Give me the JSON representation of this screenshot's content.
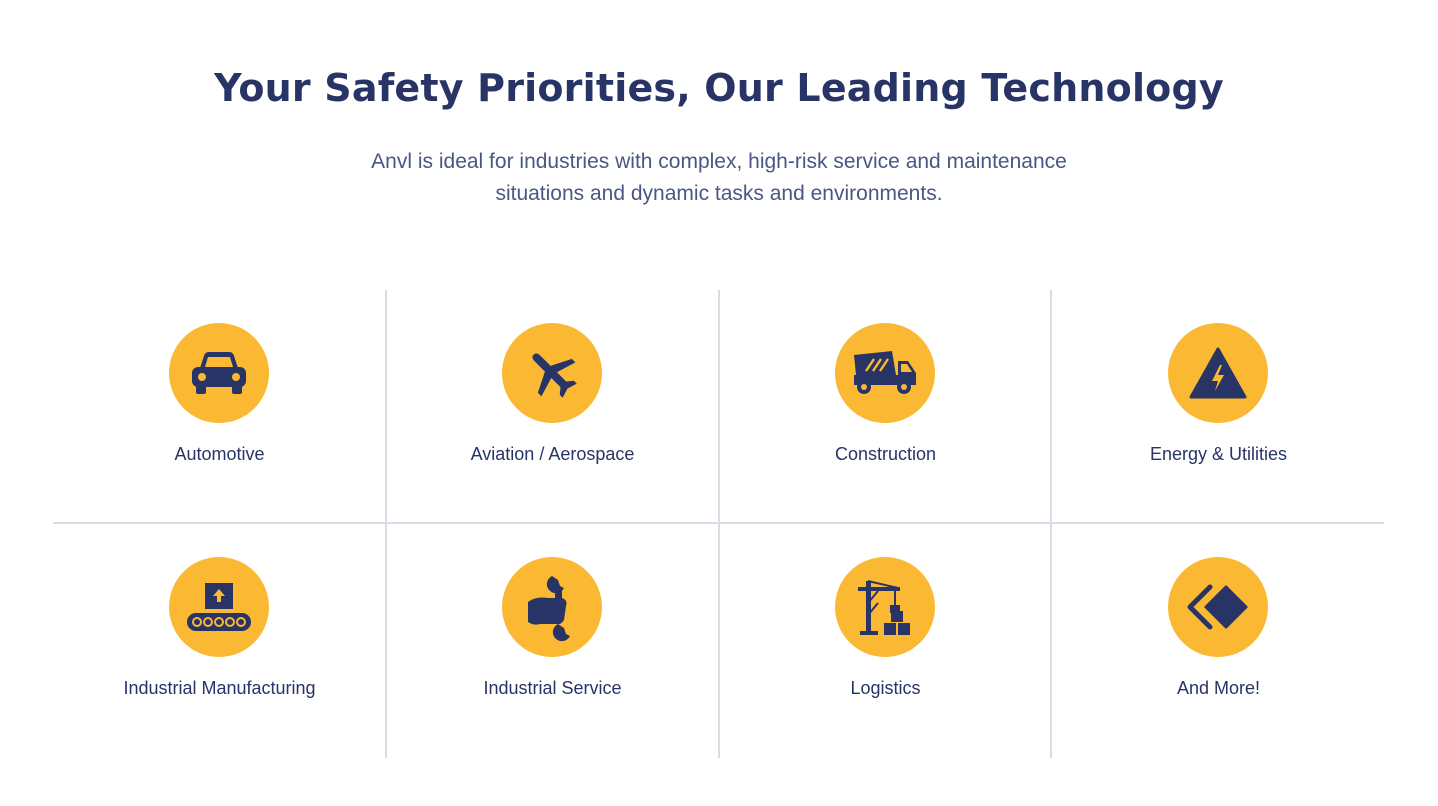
{
  "header": {
    "title": "Your Safety Priorities, Our Leading Technology",
    "subtitle_line1": "Anvl is ideal for industries with complex, high-risk service and maintenance",
    "subtitle_line2": "situations and dynamic tasks and environments."
  },
  "industries": [
    {
      "label": "Automotive",
      "icon": "car-icon"
    },
    {
      "label": "Aviation / Aerospace",
      "icon": "airplane-icon"
    },
    {
      "label": "Construction",
      "icon": "dump-truck-icon"
    },
    {
      "label": "Energy & Utilities",
      "icon": "high-voltage-warning-icon"
    },
    {
      "label": "Industrial Manufacturing",
      "icon": "conveyor-belt-icon"
    },
    {
      "label": "Industrial Service",
      "icon": "hand-wrench-icon"
    },
    {
      "label": "Logistics",
      "icon": "crane-boxes-icon"
    },
    {
      "label": "And More!",
      "icon": "diamond-shapes-icon"
    }
  ],
  "colors": {
    "heading": "#283466",
    "body_text": "#4a5785",
    "icon_circle": "#fbb933",
    "icon_glyph": "#283466",
    "divider": "#d9dbe6"
  }
}
